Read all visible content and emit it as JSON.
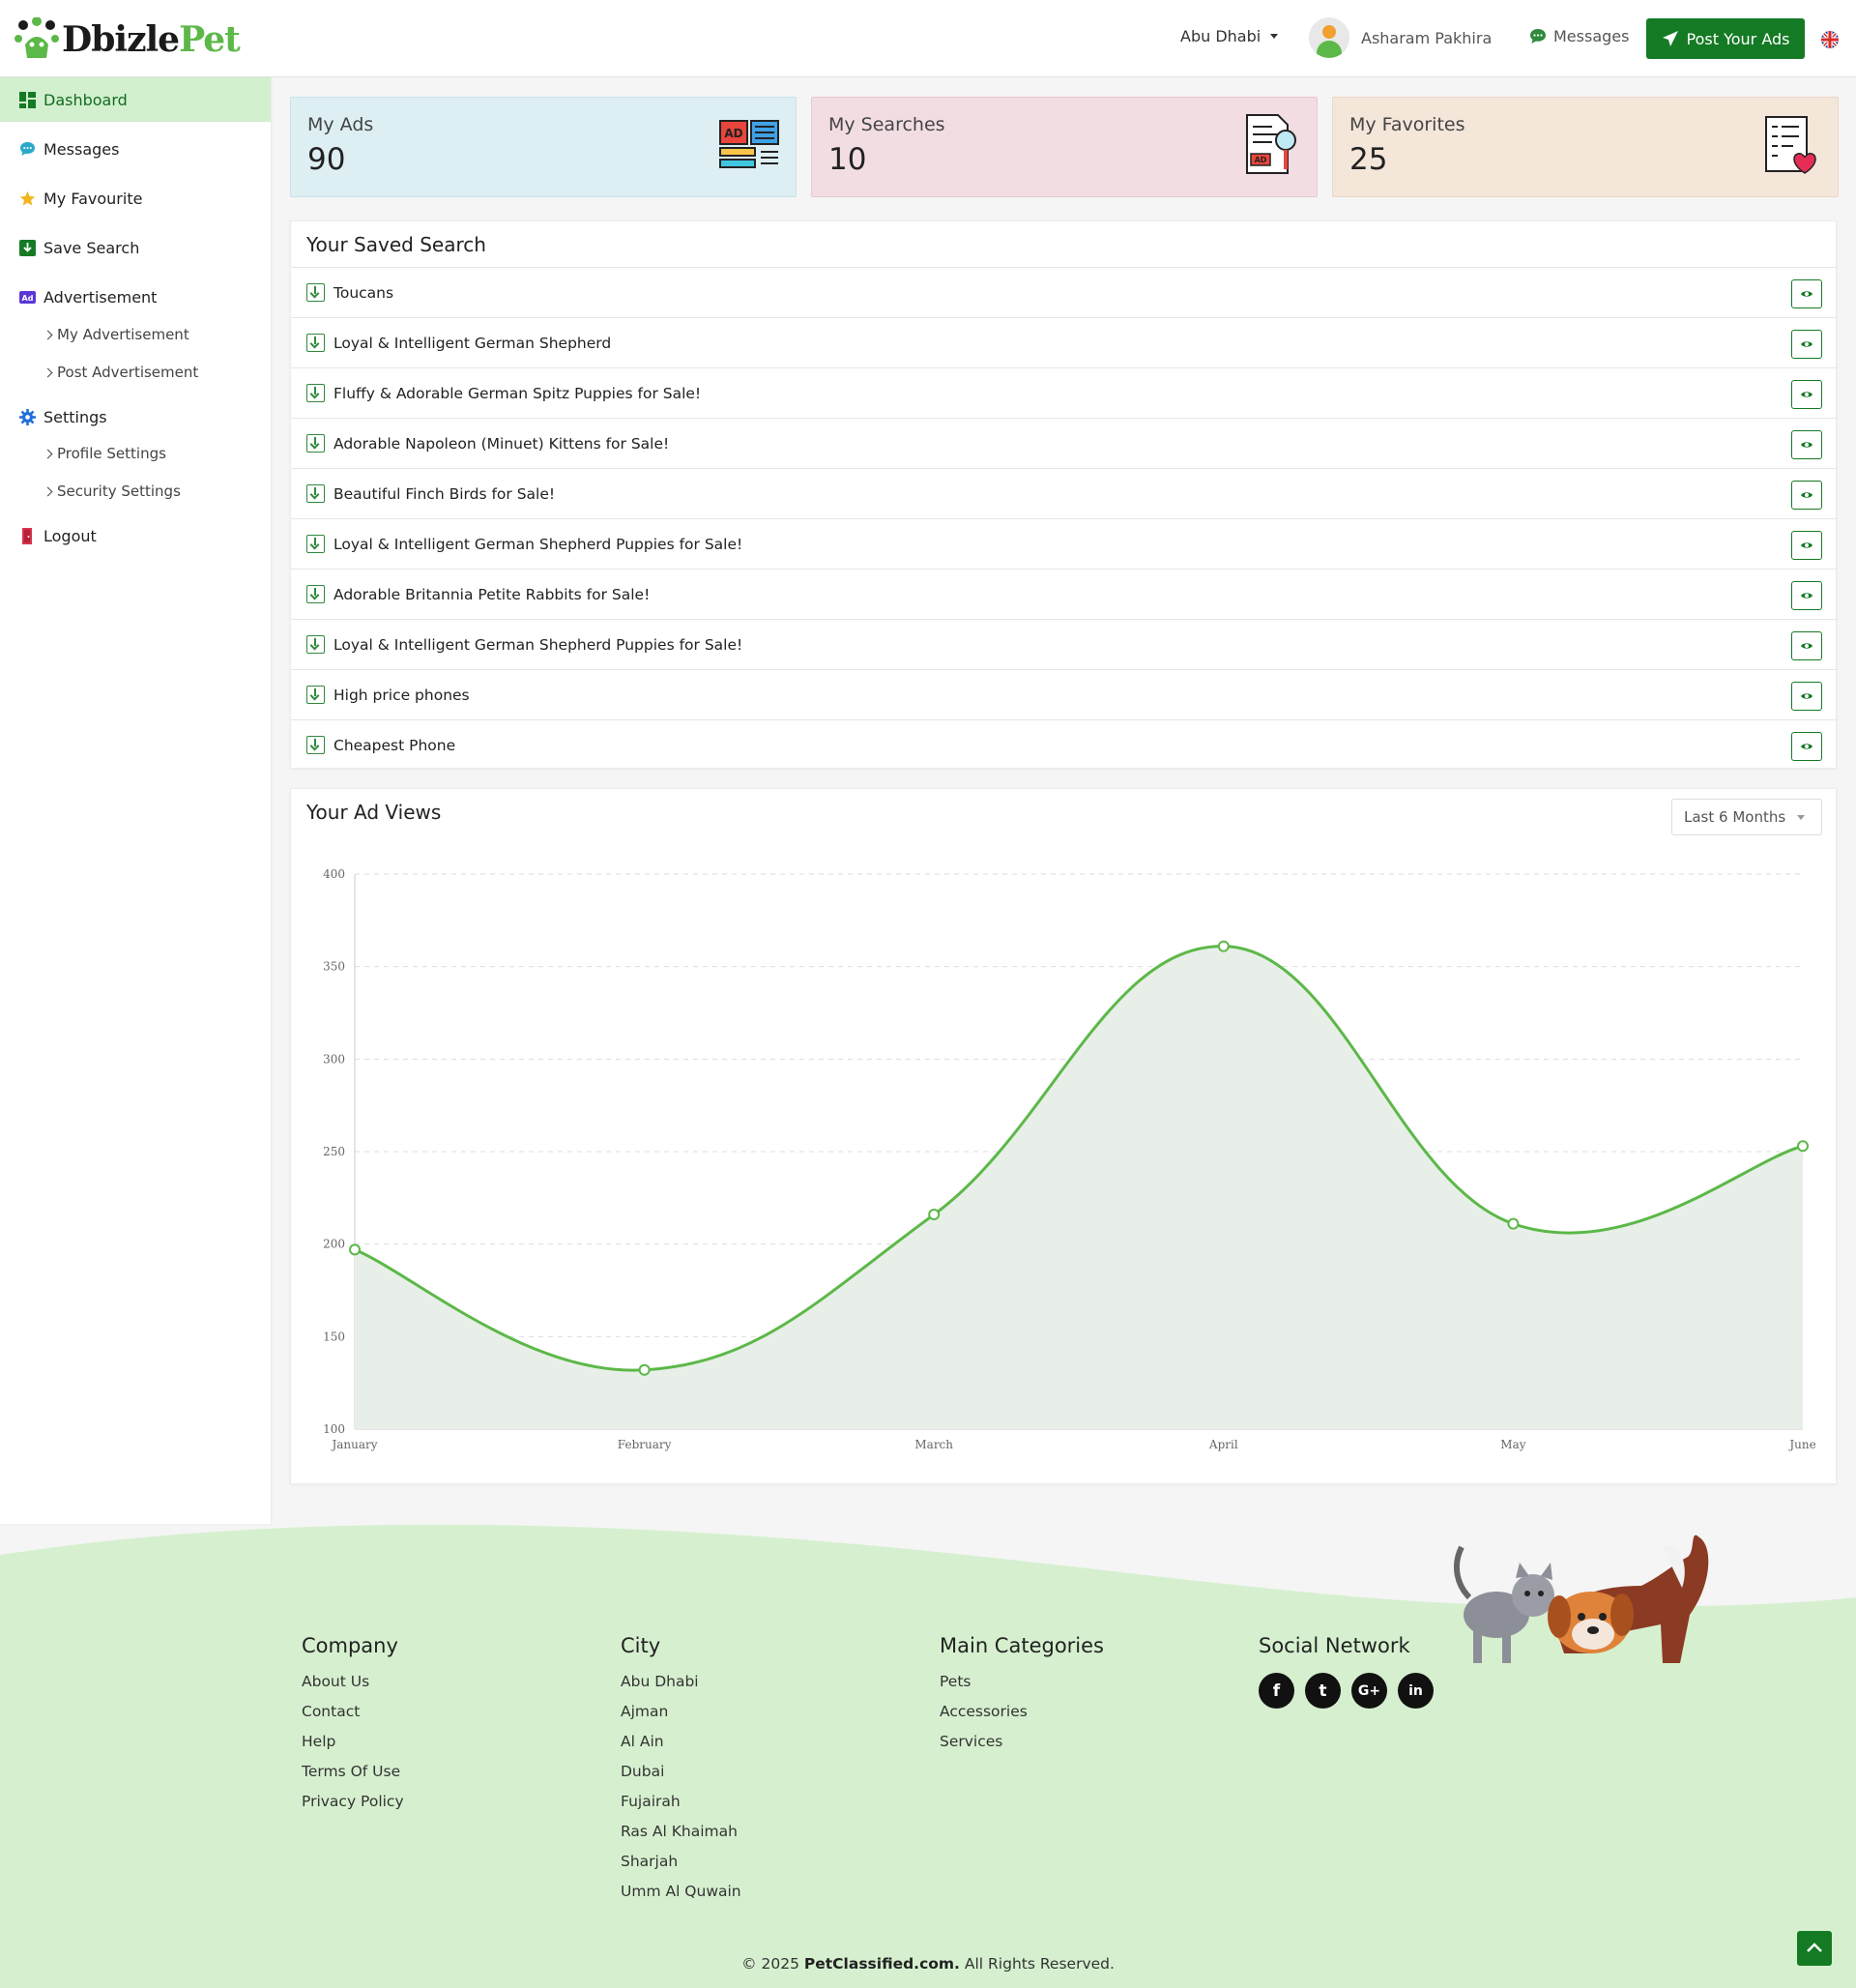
{
  "header": {
    "logo_part1": "Dbizle",
    "logo_part2": "Pet",
    "city": "Abu Dhabi",
    "user_name": "Asharam Pakhira",
    "messages_label": "Messages",
    "post_button": "Post Your Ads"
  },
  "sidebar": {
    "items": [
      {
        "label": "Dashboard",
        "icon": "dashboard-icon"
      },
      {
        "label": "Messages",
        "icon": "chat-icon"
      },
      {
        "label": "My Favourite",
        "icon": "star-icon"
      },
      {
        "label": "Save Search",
        "icon": "download-icon"
      },
      {
        "label": "Advertisement",
        "icon": "ad-icon"
      },
      {
        "label": "Settings",
        "icon": "gear-icon"
      },
      {
        "label": "Logout",
        "icon": "logout-icon"
      }
    ],
    "ad_subitems": [
      "My Advertisement",
      "Post Advertisement"
    ],
    "settings_subitems": [
      "Profile Settings",
      "Security Settings"
    ]
  },
  "stats": [
    {
      "label": "My Ads",
      "value": "90",
      "color": "#ddeff3"
    },
    {
      "label": "My Searches",
      "value": "10",
      "color": "#f2dde3"
    },
    {
      "label": "My Favorites",
      "value": "25",
      "color": "#f5e6da"
    }
  ],
  "saved_search": {
    "title": "Your Saved Search",
    "items": [
      "Toucans",
      "Loyal & Intelligent German Shepherd",
      "Fluffy & Adorable German Spitz Puppies for Sale!",
      "Adorable Napoleon (Minuet) Kittens for Sale!",
      "Beautiful Finch Birds for Sale!",
      "Loyal & Intelligent German Shepherd Puppies for Sale!",
      "Adorable Britannia Petite Rabbits for Sale!",
      "Loyal & Intelligent German Shepherd Puppies for Sale!",
      "High price phones",
      "Cheapest Phone"
    ]
  },
  "ad_views": {
    "title": "Your Ad Views",
    "range_select": "Last 6 Months"
  },
  "chart_data": {
    "type": "line",
    "categories": [
      "January",
      "February",
      "March",
      "April",
      "May",
      "June"
    ],
    "series": [
      {
        "values": [
          197,
          132,
          216,
          361,
          211,
          253
        ]
      }
    ],
    "ylim": [
      100,
      400
    ],
    "yticks": [
      100,
      150,
      200,
      250,
      300,
      350,
      400
    ],
    "grid": true,
    "line_color": "#5cb848",
    "fill_color": "#e8efe8"
  },
  "footer": {
    "company": {
      "title": "Company",
      "links": [
        "About Us",
        "Contact",
        "Help",
        "Terms Of Use",
        "Privacy Policy"
      ]
    },
    "city": {
      "title": "City",
      "links": [
        "Abu Dhabi",
        "Ajman",
        "Al Ain",
        "Dubai",
        "Fujairah",
        "Ras Al Khaimah",
        "Sharjah",
        "Umm Al Quwain"
      ]
    },
    "categories": {
      "title": "Main Categories",
      "links": [
        "Pets",
        "Accessories",
        "Services"
      ]
    },
    "social": {
      "title": "Social Network",
      "icons": [
        "facebook-icon",
        "twitter-icon",
        "google-plus-icon",
        "linkedin-icon"
      ],
      "glyphs": [
        "f",
        "t",
        "G+",
        "in"
      ]
    },
    "copyright_prefix": "© 2025",
    "copyright_site": "PetClassified.com.",
    "copyright_suffix": "All Rights Reserved."
  }
}
